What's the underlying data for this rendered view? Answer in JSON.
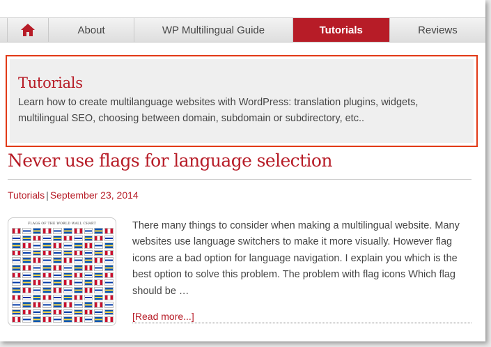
{
  "nav": {
    "home_icon": "home-icon",
    "items": [
      {
        "label": "About"
      },
      {
        "label": "WP Multilingual Guide"
      },
      {
        "label": "Tutorials",
        "active": true
      },
      {
        "label": "Reviews"
      }
    ],
    "active_color": "#b71c27"
  },
  "category": {
    "title": "Tutorials",
    "description": "Learn how to create multilanguage websites with WordPress: translation plugins, widgets, multilingual SEO, choosing between domain, subdomain or subdirectory, etc..",
    "highlight_border_color": "#e23a17"
  },
  "post": {
    "title": "Never use flags for language selection",
    "category": "Tutorials",
    "separator": "|",
    "date": "September 23, 2014",
    "thumbnail_caption": "FLAGS OF THE WORLD WALL CHART",
    "excerpt": "There many things to consider when making a multilingual website. Many websites use language switchers to make it more visually. However flag icons are a bad option for language navigation. I explain you which is the best option to solve this problem. The problem with flag icons Which flag should be …",
    "read_more": "[Read more...]"
  }
}
